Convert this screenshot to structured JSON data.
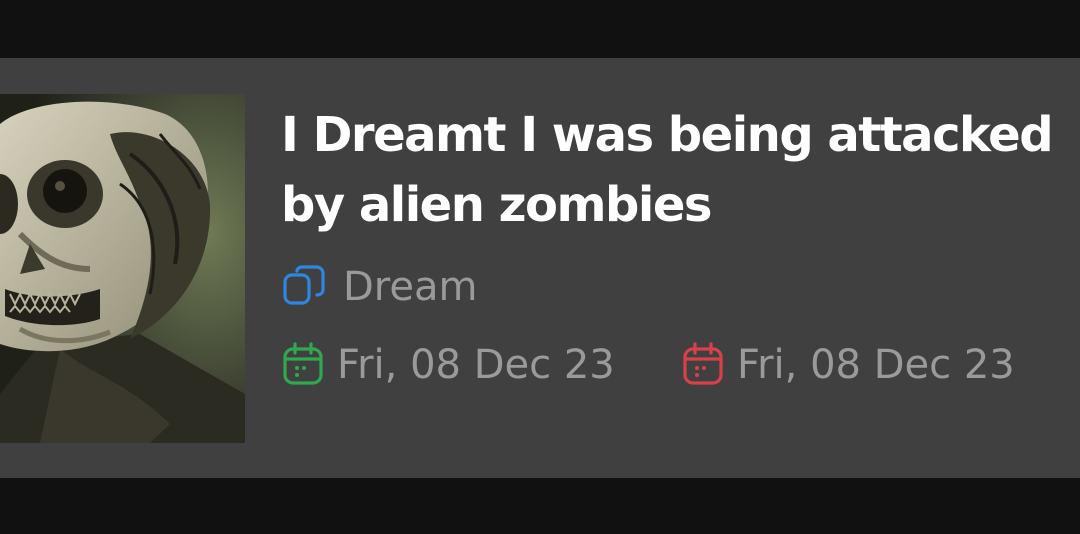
{
  "entry": {
    "title": "I Dreamt I was being attacked by alien zombies",
    "category": {
      "label": "Dream",
      "icon": "copy-icon",
      "color": "#2f86e0"
    },
    "start_date": {
      "label": "Fri, 08 Dec 23",
      "icon": "calendar-icon",
      "color": "#2fa84f"
    },
    "end_date": {
      "label": "Fri, 08 Dec 23",
      "icon": "calendar-icon",
      "color": "#d9414a"
    }
  },
  "colors": {
    "background": "#111111",
    "card": "#404040",
    "title": "#ffffff",
    "meta_text": "#9a9a9a"
  }
}
